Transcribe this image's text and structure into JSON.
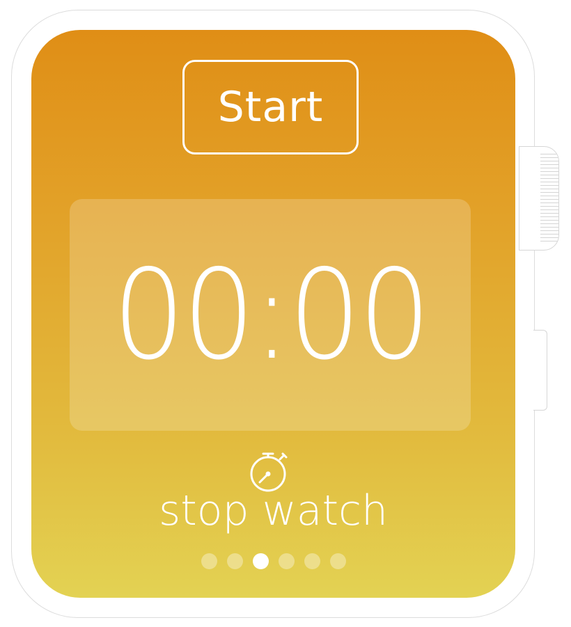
{
  "start_button": {
    "label": "Start"
  },
  "timer": {
    "display": "00:00"
  },
  "app": {
    "name": "stop watch",
    "icon": "stopwatch-icon"
  },
  "pagination": {
    "total": 6,
    "active_index": 2
  },
  "colors": {
    "screen_top": "#e08e16",
    "screen_bottom": "#e3d253",
    "foreground": "#ffffff"
  }
}
